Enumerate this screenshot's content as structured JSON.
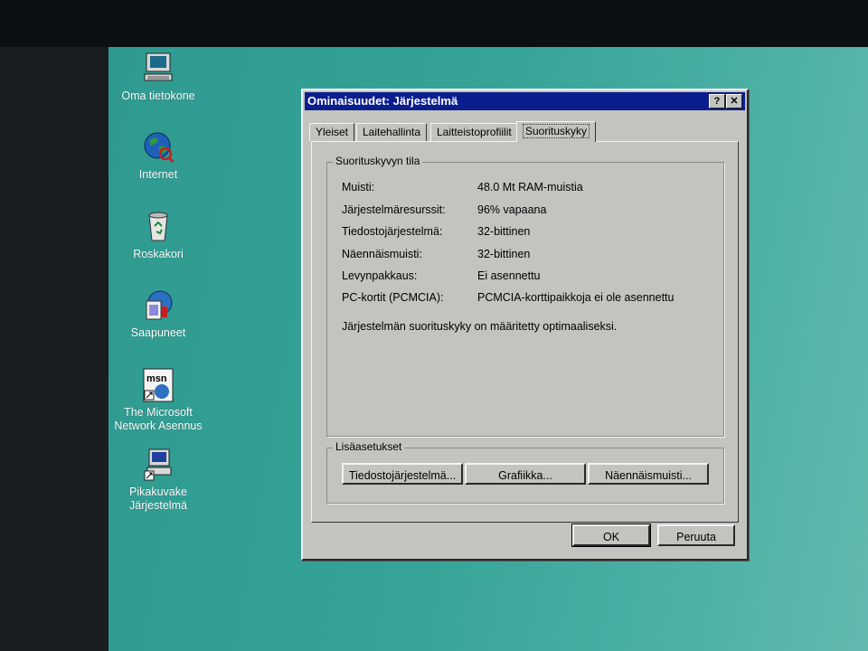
{
  "desktop": {
    "icons": [
      {
        "label": "Oma tietokone",
        "icon": "my-computer-icon"
      },
      {
        "label": "Internet",
        "icon": "internet-globe-icon"
      },
      {
        "label": "Roskakori",
        "icon": "recycle-bin-icon"
      },
      {
        "label": "Saapuneet",
        "icon": "inbox-icon"
      },
      {
        "label": "The Microsoft Network Asennus",
        "icon": "msn-setup-icon"
      },
      {
        "label": "Pikakuvake Järjestelmä",
        "icon": "system-shortcut-icon"
      }
    ]
  },
  "window": {
    "title": "Ominaisuudet: Järjestelmä",
    "help_symbol": "?",
    "close_symbol": "✕",
    "tabs": [
      "Yleiset",
      "Laitehallinta",
      "Laitteistoprofiilit",
      "Suorituskyky"
    ],
    "active_tab": "Suorituskyky",
    "status_group": {
      "caption": "Suorituskyvyn tila",
      "rows": [
        {
          "label": "Muisti:",
          "value": "48.0 Mt RAM-muistia"
        },
        {
          "label": "Järjestelmäresurssit:",
          "value": "96% vapaana"
        },
        {
          "label": "Tiedostojärjestelmä:",
          "value": "32-bittinen"
        },
        {
          "label": "Näennäismuisti:",
          "value": "32-bittinen"
        },
        {
          "label": "Levynpakkaus:",
          "value": "Ei asennettu"
        },
        {
          "label": "PC-kortit (PCMCIA):",
          "value": "PCMCIA-korttipaikkoja ei ole asennettu"
        }
      ],
      "message": "Järjestelmän suorituskyky on määritetty optimaaliseksi."
    },
    "advanced_group": {
      "caption": "Lisäasetukset",
      "buttons": [
        "Tiedostojärjestelmä...",
        "Grafiikka...",
        "Näennäismuisti..."
      ]
    },
    "ok_label": "OK",
    "cancel_label": "Peruuta"
  },
  "colors": {
    "desktop": "#35a397",
    "titlebar": "#0b1e8e",
    "window_face": "#c3c3c0"
  }
}
